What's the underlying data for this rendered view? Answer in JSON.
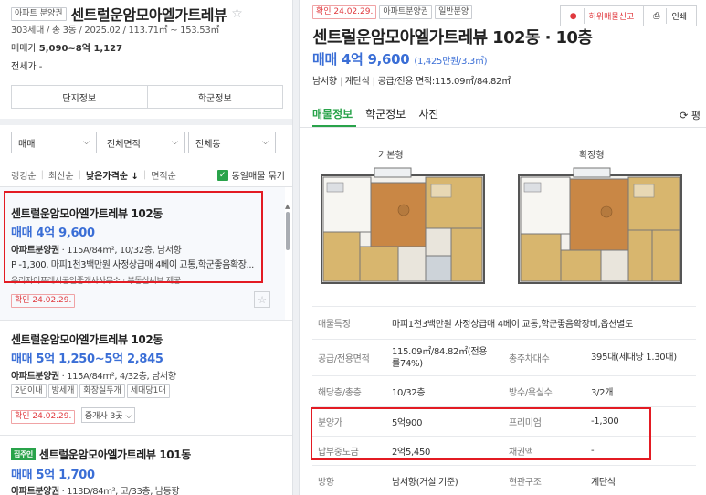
{
  "left": {
    "complex_tag": "아파트 분양권",
    "complex_title": "센트럴운암모아엘가트레뷰",
    "complex_sub": "303세대 / 총 3동 / 2025.02 / 113.71㎡ ~ 153.53㎡",
    "sale_label": "매매가",
    "sale_value": "5,090~8억 1,127",
    "jeonse_label": "전세가",
    "jeonse_value": "-",
    "btn_complex_info": "단지정보",
    "btn_school_info": "학군정보",
    "filters": [
      {
        "label": "매매"
      },
      {
        "label": "전체면적"
      },
      {
        "label": "전체동"
      }
    ],
    "sort": {
      "ranking": "랭킹순",
      "latest": "최신순",
      "low_price": "낮은가격순 ↓",
      "area": "면적순",
      "same_listing": "동일매물 묶기"
    },
    "listings": [
      {
        "title": "센트럴운암모아엘가트레뷰 102동",
        "price": "매매 4억 9,600",
        "type": "아파트분양권",
        "detail": " · 115A/84m², 10/32층, 남서향",
        "desc": "P -1,300, 마피1천3백만원 사정상급매 4베이 교통,학군좋음확장...",
        "realtor": "우리자이프레시공인중개사사무소 · 부동산써브 제공",
        "confirm": "확인 24.02.29."
      },
      {
        "title": "센트럴운암모아엘가트레뷰 102동",
        "price": "매매 5억 1,250~5억 2,845",
        "type": "아파트분양권",
        "detail": " · 115A/84m², 4/32층, 남서향",
        "tags": [
          "2년이내",
          "방세개",
          "화장실두개",
          "세대당1대"
        ],
        "confirm": "확인 24.02.29.",
        "broker": "중개사 3곳 ⌵"
      },
      {
        "owner_tag": "집주인",
        "title": "센트럴운암모아엘가트레뷰 101동",
        "price": "매매 5억 1,700",
        "type": "아파트분양권",
        "detail": " · 113D/84m², 고/33층, 남동향"
      }
    ]
  },
  "right": {
    "tags": [
      "확인 24.02.29.",
      "아파트분양권",
      "일반분양"
    ],
    "report": "허위매물신고",
    "print": "인쇄",
    "title": "센트럴운암모아엘가트레뷰 102동 · 10층",
    "price": "매매 4억 9,600",
    "price_per": "(1,425만원/3.3㎡)",
    "meta": [
      "남서향",
      "계단식",
      "공급/전용 면적:115.09㎡/84.82㎡"
    ],
    "tabs": [
      "매물정보",
      "학군정보",
      "사진"
    ],
    "refresh": "⟳ 평",
    "plan_basic": "기본형",
    "plan_ext": "확장형",
    "info": {
      "feature_label": "매물특징",
      "feature_value": "마피1천3백만원 사정상급매 4베이 교통,학군좋음확장비,옵션별도",
      "area_label": "공급/전용면적",
      "area_value": "115.09㎡/84.82㎡(전용률74%)",
      "parking_label": "총주차대수",
      "parking_value": "395대(세대당 1.30대)",
      "floor_label": "해당층/총층",
      "floor_value": "10/32층",
      "rooms_label": "방수/욕실수",
      "rooms_value": "3/2개",
      "presale_label": "분양가",
      "presale_value": "5억900",
      "premium_label": "프리미엄",
      "premium_value": "-1,300",
      "paid_label": "납부중도금",
      "paid_value": "2억5,450",
      "loan_label": "채권액",
      "loan_value": "-",
      "dir_label": "방향",
      "dir_value": "남서향(거실 기준)",
      "entry_label": "현관구조",
      "entry_value": "계단식"
    }
  },
  "colors": {
    "accent_green": "#29a34a",
    "price_blue": "#3a6ed6",
    "highlight_red": "#e31b23"
  }
}
